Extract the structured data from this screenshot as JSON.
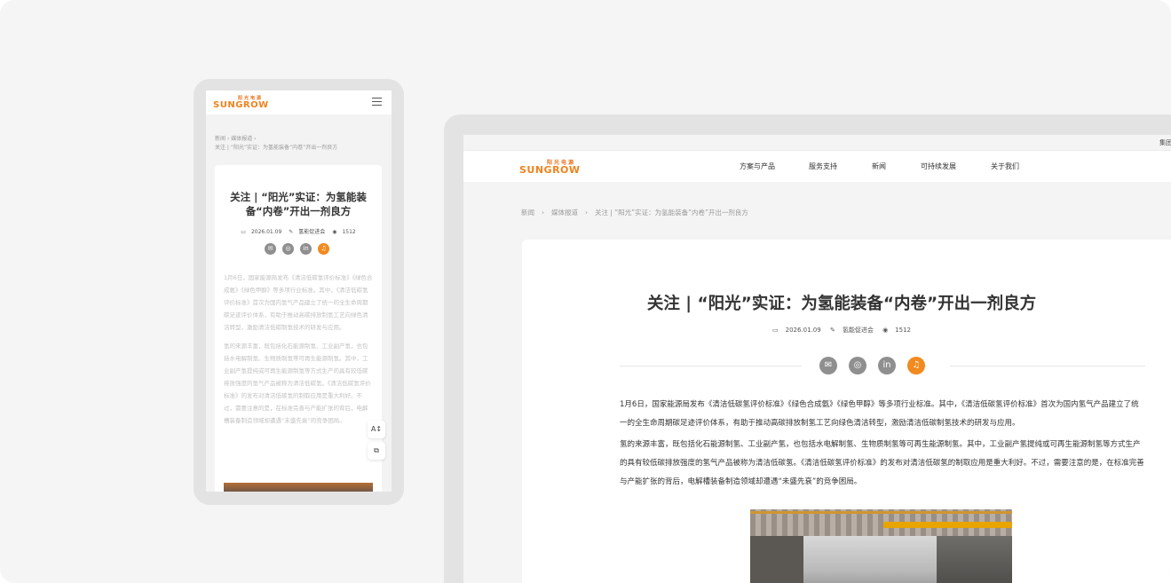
{
  "brand": {
    "logo_cn": "阳光电源",
    "logo_en": "SUNGROW",
    "colors": {
      "brand_orange": "#f0821e",
      "share_gray": "#8f8f8f",
      "share_active": "#f18a1f",
      "page_bg": "#f5f5f5"
    }
  },
  "desktop": {
    "topbar": {
      "group_link": "集团"
    },
    "nav": [
      "方案与产品",
      "服务支持",
      "新闻",
      "可持续发展",
      "关于我们"
    ],
    "breadcrumb": [
      "新闻",
      "媒体报道",
      "关注 | “阳光”实证：为氢能装备“内卷”开出一剂良方"
    ],
    "article": {
      "title": "关注 | “阳光”实证：为氢能装备“内卷”开出一剂良方",
      "date": "2026.01.09",
      "author": "氢能促进会",
      "views": "1512",
      "share_icons": [
        "wechat-icon",
        "weibo-icon",
        "linkedin-icon",
        "headphones-icon"
      ],
      "paragraphs": [
        "1月6日，国家能源局发布《清洁低碳氢评价标准》《绿色合成氨》《绿色甲醇》等多项行业标准。其中，《清洁低碳氢评价标准》首次为国内氢气产品建立了统一的全生命周期碳足迹评价体系，有助于推动高碳排放制氢工艺向绿色清洁转型，激励清洁低碳制氢技术的研发与应用。",
        "氢的来源丰富，既包括化石能源制氢、工业副产氢，也包括水电解制氢、生物质制氢等可再生能源制氢。其中，工业副产氢提纯或可再生能源制氢等方式生产的具有较低碳排放强度的氢气产品被称为清洁低碳氢。《清洁低碳氢评价标准》的发布对清洁低碳氢的制取应用是重大利好。不过，需要注意的是，在标准完善与产能扩张的背后，电解槽装备制造领域却遭遇“未盛先衰”的竞争困局。"
      ]
    }
  },
  "mobile": {
    "breadcrumb_line1": "新闻  ›  媒体报道  ›",
    "breadcrumb_line2": "关注 | “阳光”实证：为氢能装备“内卷”开出一剂良方",
    "title": "关注 | “阳光”实证：为氢能装备“内卷”开出一剂良方",
    "date": "2026.01.09",
    "author": "氢能促进会",
    "views": "1512",
    "paragraphs": [
      "1月6日，国家能源局发布《清洁低碳氢评价标准》《绿色合成氨》《绿色甲醇》等多项行业标准。其中，《清洁低碳氢评价标准》首次为国内氢气产品建立了统一的全生命周期碳足迹评价体系，有助于推动高碳排放制氢工艺向绿色清洁转型，激励清洁低碳制氢技术的研发与应用。",
      "氢的来源丰富，既包括化石能源制氢、工业副产氢，也包括水电解制氢、生物质制氢等可再生能源制氢。其中，工业副产氢提纯或可再生能源制氢等方式生产的具有较低碳排放强度的氢气产品被称为清洁低碳氢。《清洁低碳氢评价标准》的发布对清洁低碳氢的制取应用是重大利好。不过，需要注意的是，在标准完善与产能扩张的背后，电解槽装备制造领域却遭遇“未盛先衰”的竞争困局。"
    ],
    "float_font_label": "A↕",
    "float_copy_label": "⧉"
  }
}
